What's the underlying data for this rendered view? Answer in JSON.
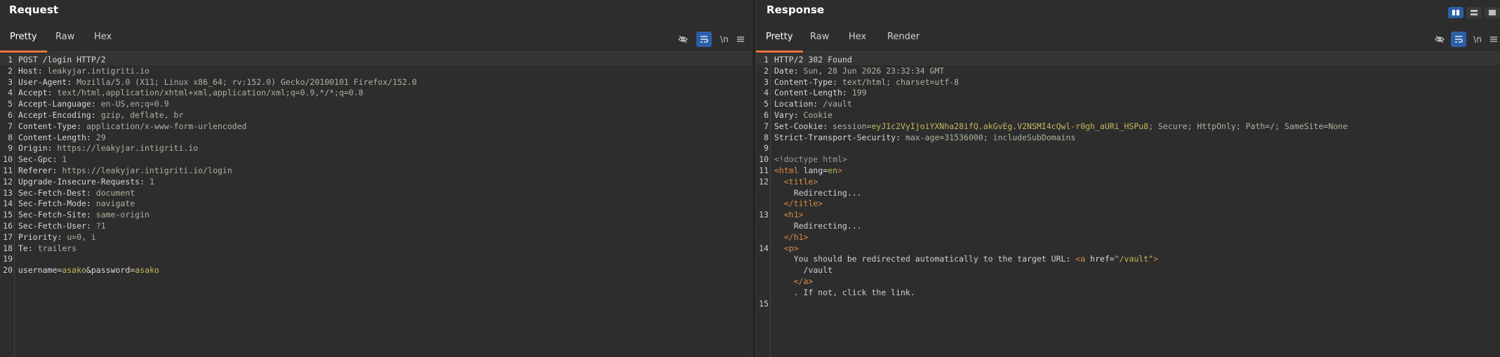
{
  "request": {
    "title": "Request",
    "tabs": [
      "Pretty",
      "Raw",
      "Hex"
    ],
    "active_tab": "Pretty",
    "toolbar_newline": "\\n",
    "lines": [
      {
        "n": "1",
        "parts": [
          {
            "c": "k",
            "t": "POST /login HTTP/2"
          }
        ]
      },
      {
        "n": "2",
        "parts": [
          {
            "c": "k",
            "t": "Host: "
          },
          {
            "c": "v",
            "t": "leakyjar.intigriti.io"
          }
        ]
      },
      {
        "n": "3",
        "parts": [
          {
            "c": "k",
            "t": "User-Agent: "
          },
          {
            "c": "v",
            "t": "Mozilla/5.0 (X11; Linux x86_64; rv:152.0) Gecko/20100101 Firefox/152.0"
          }
        ]
      },
      {
        "n": "4",
        "parts": [
          {
            "c": "k",
            "t": "Accept: "
          },
          {
            "c": "v",
            "t": "text/html,application/xhtml+xml,application/xml;q=0.9,*/*;q=0.8"
          }
        ]
      },
      {
        "n": "5",
        "parts": [
          {
            "c": "k",
            "t": "Accept-Language: "
          },
          {
            "c": "v",
            "t": "en-US,en;q=0.9"
          }
        ]
      },
      {
        "n": "6",
        "parts": [
          {
            "c": "k",
            "t": "Accept-Encoding: "
          },
          {
            "c": "v",
            "t": "gzip, deflate, br"
          }
        ]
      },
      {
        "n": "7",
        "parts": [
          {
            "c": "k",
            "t": "Content-Type: "
          },
          {
            "c": "v",
            "t": "application/x-www-form-urlencoded"
          }
        ]
      },
      {
        "n": "8",
        "parts": [
          {
            "c": "k",
            "t": "Content-Length: "
          },
          {
            "c": "v",
            "t": "29"
          }
        ]
      },
      {
        "n": "9",
        "parts": [
          {
            "c": "k",
            "t": "Origin: "
          },
          {
            "c": "v",
            "t": "https://leakyjar.intigriti.io"
          }
        ]
      },
      {
        "n": "10",
        "parts": [
          {
            "c": "k",
            "t": "Sec-Gpc: "
          },
          {
            "c": "v",
            "t": "1"
          }
        ]
      },
      {
        "n": "11",
        "parts": [
          {
            "c": "k",
            "t": "Referer: "
          },
          {
            "c": "v",
            "t": "https://leakyjar.intigriti.io/login"
          }
        ]
      },
      {
        "n": "12",
        "parts": [
          {
            "c": "k",
            "t": "Upgrade-Insecure-Requests: "
          },
          {
            "c": "v",
            "t": "1"
          }
        ]
      },
      {
        "n": "13",
        "parts": [
          {
            "c": "k",
            "t": "Sec-Fetch-Dest: "
          },
          {
            "c": "v",
            "t": "document"
          }
        ]
      },
      {
        "n": "14",
        "parts": [
          {
            "c": "k",
            "t": "Sec-Fetch-Mode: "
          },
          {
            "c": "v",
            "t": "navigate"
          }
        ]
      },
      {
        "n": "15",
        "parts": [
          {
            "c": "k",
            "t": "Sec-Fetch-Site: "
          },
          {
            "c": "v",
            "t": "same-origin"
          }
        ]
      },
      {
        "n": "16",
        "parts": [
          {
            "c": "k",
            "t": "Sec-Fetch-User: "
          },
          {
            "c": "v",
            "t": "?1"
          }
        ]
      },
      {
        "n": "17",
        "parts": [
          {
            "c": "k",
            "t": "Priority: "
          },
          {
            "c": "v",
            "t": "u=0, i"
          }
        ]
      },
      {
        "n": "18",
        "parts": [
          {
            "c": "k",
            "t": "Te: "
          },
          {
            "c": "v",
            "t": "trailers"
          }
        ]
      },
      {
        "n": "19",
        "parts": []
      },
      {
        "n": "20",
        "parts": [
          {
            "c": "k",
            "t": "username="
          },
          {
            "c": "s",
            "t": "asako"
          },
          {
            "c": "k",
            "t": "&password="
          },
          {
            "c": "s",
            "t": "asako"
          }
        ]
      }
    ]
  },
  "response": {
    "title": "Response",
    "tabs": [
      "Pretty",
      "Raw",
      "Hex",
      "Render"
    ],
    "active_tab": "Pretty",
    "toolbar_newline": "\\n",
    "lines": [
      {
        "n": "1",
        "parts": [
          {
            "c": "k",
            "t": "HTTP/2 302 Found"
          }
        ]
      },
      {
        "n": "2",
        "parts": [
          {
            "c": "k",
            "t": "Date: "
          },
          {
            "c": "v",
            "t": "Sun, 28 Jun 2026 23:32:34 GMT"
          }
        ]
      },
      {
        "n": "3",
        "parts": [
          {
            "c": "k",
            "t": "Content-Type: "
          },
          {
            "c": "v",
            "t": "text/html; charset=utf-8"
          }
        ]
      },
      {
        "n": "4",
        "parts": [
          {
            "c": "k",
            "t": "Content-Length: "
          },
          {
            "c": "v",
            "t": "199"
          }
        ]
      },
      {
        "n": "5",
        "parts": [
          {
            "c": "k",
            "t": "Location: "
          },
          {
            "c": "v",
            "t": "/vault"
          }
        ]
      },
      {
        "n": "6",
        "parts": [
          {
            "c": "k",
            "t": "Vary: "
          },
          {
            "c": "v",
            "t": "Cookie"
          }
        ]
      },
      {
        "n": "7",
        "parts": [
          {
            "c": "k",
            "t": "Set-Cookie: "
          },
          {
            "c": "v",
            "t": "session="
          },
          {
            "c": "s",
            "t": "eyJ1c2VyIjoiYXNha28ifQ.akGvEg.V2NSMI4cQwl-r0gh_aURi_HSPu8"
          },
          {
            "c": "v",
            "t": "; Secure; HttpOnly; Path=/; SameSite=None"
          }
        ]
      },
      {
        "n": "8",
        "parts": [
          {
            "c": "k",
            "t": "Strict-Transport-Security: "
          },
          {
            "c": "v",
            "t": "max-age=31536000; includeSubDomains"
          }
        ]
      },
      {
        "n": "9",
        "parts": []
      },
      {
        "n": "10",
        "parts": [
          {
            "c": "g",
            "t": "<!doctype html>"
          }
        ]
      },
      {
        "n": "11",
        "parts": [
          {
            "c": "t",
            "t": "<html "
          },
          {
            "c": "a",
            "t": "lang="
          },
          {
            "c": "s",
            "t": "en"
          },
          {
            "c": "t",
            "t": ">"
          }
        ]
      },
      {
        "n": "12",
        "parts": [
          {
            "c": "t",
            "t": "  <title>"
          }
        ]
      },
      {
        "n": "",
        "parts": [
          {
            "c": "txt",
            "t": "    Redirecting..."
          }
        ]
      },
      {
        "n": "",
        "parts": [
          {
            "c": "t",
            "t": "  </title>"
          }
        ]
      },
      {
        "n": "13",
        "parts": [
          {
            "c": "t",
            "t": "  <h1>"
          }
        ]
      },
      {
        "n": "",
        "parts": [
          {
            "c": "txt",
            "t": "    Redirecting..."
          }
        ]
      },
      {
        "n": "",
        "parts": [
          {
            "c": "t",
            "t": "  </h1>"
          }
        ]
      },
      {
        "n": "14",
        "parts": [
          {
            "c": "t",
            "t": "  <p>"
          }
        ]
      },
      {
        "n": "",
        "parts": [
          {
            "c": "txt",
            "t": "    You should be redirected automatically to the target URL: "
          },
          {
            "c": "t",
            "t": "<a "
          },
          {
            "c": "a",
            "t": "href="
          },
          {
            "c": "s",
            "t": "\"/vault\""
          },
          {
            "c": "t",
            "t": ">"
          }
        ]
      },
      {
        "n": "",
        "parts": [
          {
            "c": "txt",
            "t": "      /vault"
          }
        ]
      },
      {
        "n": "",
        "parts": [
          {
            "c": "t",
            "t": "    </a>"
          }
        ]
      },
      {
        "n": "",
        "parts": [
          {
            "c": "txt",
            "t": "    . If not, click the link."
          }
        ]
      },
      {
        "n": "15",
        "parts": []
      }
    ]
  },
  "colors": {
    "accent": "#e8733c",
    "toggle_on": "#2d5fa8",
    "string": "#c4b85a",
    "tag": "#d98a45"
  }
}
